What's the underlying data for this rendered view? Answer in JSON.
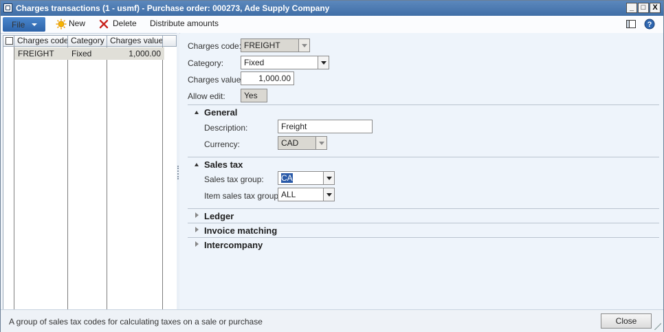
{
  "window": {
    "title": "Charges transactions (1 - usmf) - Purchase order: 000273, Ade Supply Company",
    "buttons": {
      "minimize": "_",
      "maximize": "□",
      "close": "X"
    }
  },
  "toolbar": {
    "file_label": "File",
    "new_label": "New",
    "delete_label": "Delete",
    "distribute_label": "Distribute amounts",
    "icons": [
      "sun-icon",
      "delete-x-icon",
      "layout-icon",
      "help-icon"
    ]
  },
  "grid": {
    "columns": [
      "Charges code",
      "Category",
      "Charges value"
    ],
    "rows": [
      {
        "charges_code": "FREIGHT",
        "category": "Fixed",
        "charges_value": "1,000.00"
      }
    ]
  },
  "form": {
    "charges_code_label": "Charges code:",
    "charges_code": "FREIGHT",
    "category_label": "Category:",
    "category": "Fixed",
    "charges_value_label": "Charges value:",
    "charges_value": "1,000.00",
    "allow_edit_label": "Allow edit:",
    "allow_edit": "Yes"
  },
  "general": {
    "title": "General",
    "description_label": "Description:",
    "description": "Freight",
    "currency_label": "Currency:",
    "currency": "CAD"
  },
  "sales_tax": {
    "title": "Sales tax",
    "group_label": "Sales tax group:",
    "group": "CA",
    "item_group_label": "Item sales tax group:",
    "item_group": "ALL"
  },
  "collapsed_sections": [
    "Ledger",
    "Invoice matching",
    "Intercompany"
  ],
  "status": {
    "message": "A group of sales tax codes for calculating taxes on a sale or purchase",
    "close_label": "Close"
  }
}
